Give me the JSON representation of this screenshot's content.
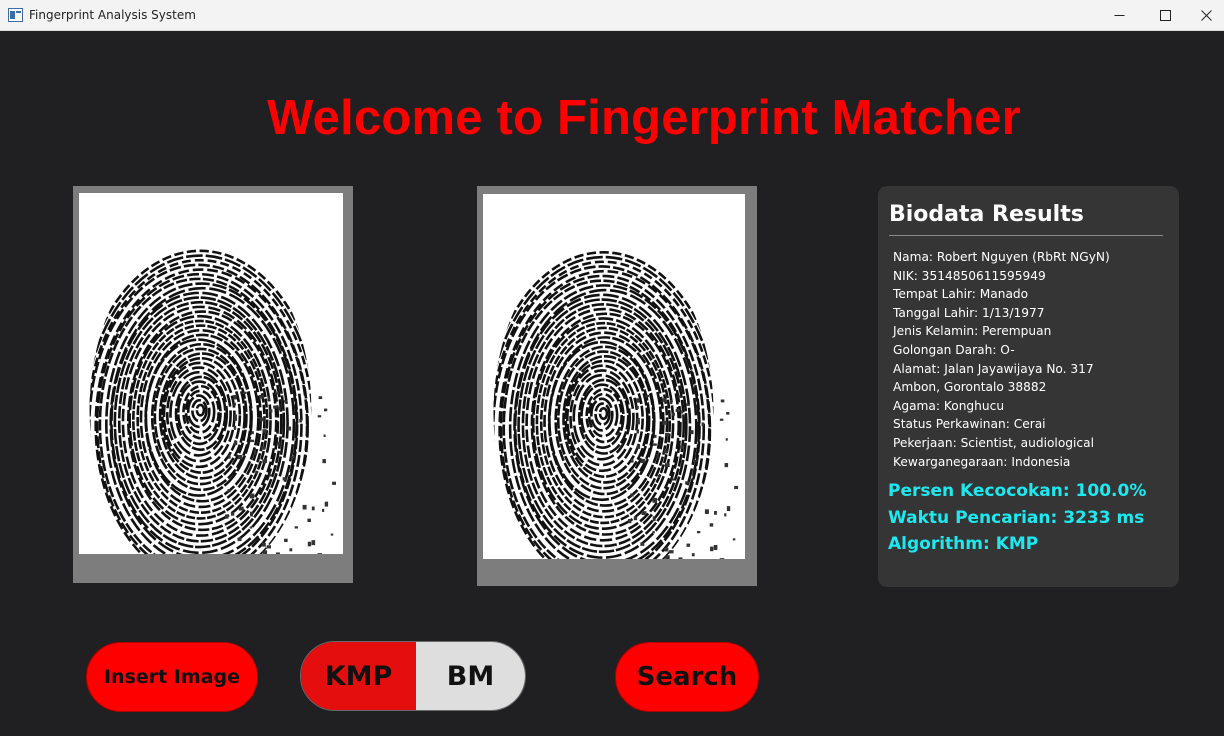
{
  "window": {
    "title": "Fingerprint Analysis System"
  },
  "header": {
    "title": "Welcome to Fingerprint Matcher"
  },
  "images": {
    "input_image": "fingerprint-icon",
    "matched_image": "fingerprint-icon"
  },
  "biodata": {
    "title": "Biodata Results",
    "lines": [
      "Nama: Robert Nguyen (RbRt NGyN)",
      "NIK: 3514850611595949",
      "Tempat Lahir: Manado",
      "Tanggal Lahir: 1/13/1977",
      "Jenis Kelamin: Perempuan",
      "Golongan Darah: O-",
      "Alamat: Jalan Jayawijaya No. 317",
      "Ambon, Gorontalo 38882",
      "Agama: Konghucu",
      "Status Perkawinan: Cerai",
      "Pekerjaan: Scientist, audiological",
      "Kewarganegaraan: Indonesia"
    ],
    "match_percent": "Persen Kecocokan: 100.0%",
    "search_time": "Waktu Pencarian: 3233 ms",
    "algorithm": "Algorithm: KMP"
  },
  "controls": {
    "insert_label": "Insert Image",
    "algo_options": [
      "KMP",
      "BM"
    ],
    "algo_selected": "KMP",
    "search_label": "Search"
  },
  "colors": {
    "background": "#201f21",
    "accent_red": "#ff0000",
    "stat_cyan": "#1de9f0",
    "panel": "#353535"
  }
}
